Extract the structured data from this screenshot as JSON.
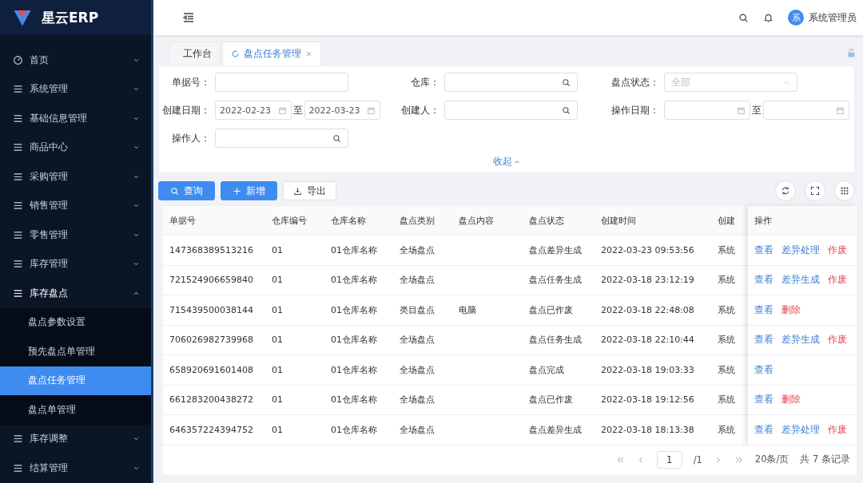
{
  "logo": {
    "text": "星云ERP"
  },
  "sidebar": {
    "items": [
      {
        "label": "首页",
        "kind": "dashboard",
        "expanded": false
      },
      {
        "label": "系统管理",
        "kind": "menu",
        "expanded": false
      },
      {
        "label": "基础信息管理",
        "kind": "menu",
        "expanded": false
      },
      {
        "label": "商品中心",
        "kind": "menu",
        "expanded": false
      },
      {
        "label": "采购管理",
        "kind": "menu",
        "expanded": false
      },
      {
        "label": "销售管理",
        "kind": "menu",
        "expanded": false
      },
      {
        "label": "零售管理",
        "kind": "menu",
        "expanded": false
      },
      {
        "label": "库存管理",
        "kind": "menu",
        "expanded": false
      },
      {
        "label": "库存盘点",
        "kind": "menu",
        "expanded": true,
        "children": [
          {
            "label": "盘点参数设置",
            "selected": false
          },
          {
            "label": "预先盘点单管理",
            "selected": false
          },
          {
            "label": "盘点任务管理",
            "selected": true
          },
          {
            "label": "盘点单管理",
            "selected": false
          }
        ]
      },
      {
        "label": "库存调整",
        "kind": "menu",
        "expanded": false
      },
      {
        "label": "结算管理",
        "kind": "menu",
        "expanded": false
      }
    ]
  },
  "header": {
    "avatar": "系",
    "user_name": "系统管理员"
  },
  "tabs": [
    {
      "label": "工作台",
      "selected": false
    },
    {
      "label": "盘点任务管理",
      "selected": true
    }
  ],
  "filter": {
    "fields": [
      {
        "label": "单据号：",
        "kind": "text"
      },
      {
        "label": "仓库：",
        "kind": "search"
      },
      {
        "label": "盘点状态：",
        "kind": "select",
        "placeholder": "全部"
      },
      {
        "label": "创建日期：",
        "kind": "date_range",
        "separator": "至",
        "values": [
          "2022-02-23",
          "2022-03-23"
        ]
      },
      {
        "label": "创建人：",
        "kind": "search"
      },
      {
        "label": "操作日期：",
        "kind": "date_range",
        "separator": "至"
      },
      {
        "label": "操作人：",
        "kind": "search"
      }
    ],
    "collapse_link": "收起"
  },
  "toolbar": {
    "buttons": [
      {
        "label": "查询",
        "kind": "primary"
      },
      {
        "label": "新增",
        "kind": "primary"
      },
      {
        "label": "导出",
        "kind": "default"
      }
    ]
  },
  "table": {
    "columns": [
      "单据号",
      "仓库编号",
      "仓库名称",
      "盘点类别",
      "盘点内容",
      "盘点状态",
      "创建时间",
      "创建",
      "操作"
    ],
    "rows": [
      {
        "cells": [
          "147368389513216",
          "01",
          "01仓库名称",
          "全场盘点",
          "",
          "盘点差异生成",
          "2022-03-23 09:53:56",
          "系统"
        ],
        "actions": [
          {
            "label": "查看",
            "kind": "normal"
          },
          {
            "label": "差异处理",
            "kind": "normal"
          },
          {
            "label": "作废",
            "kind": "danger"
          }
        ]
      },
      {
        "cells": [
          "721524906659840",
          "01",
          "01仓库名称",
          "全场盘点",
          "",
          "盘点任务生成",
          "2022-03-18 23:12:19",
          "系统"
        ],
        "actions": [
          {
            "label": "查看",
            "kind": "normal"
          },
          {
            "label": "差异生成",
            "kind": "normal"
          },
          {
            "label": "作废",
            "kind": "danger"
          }
        ]
      },
      {
        "cells": [
          "715439500038144",
          "01",
          "01仓库名称",
          "类目盘点",
          "电脑",
          "盘点已作废",
          "2022-03-18 22:48:08",
          "系统"
        ],
        "actions": [
          {
            "label": "查看",
            "kind": "normal"
          },
          {
            "label": "删除",
            "kind": "danger"
          }
        ]
      },
      {
        "cells": [
          "706026982739968",
          "01",
          "01仓库名称",
          "全场盘点",
          "",
          "盘点任务生成",
          "2022-03-18 22:10:44",
          "系统"
        ],
        "actions": [
          {
            "label": "查看",
            "kind": "normal"
          },
          {
            "label": "差异生成",
            "kind": "normal"
          },
          {
            "label": "作废",
            "kind": "danger"
          }
        ]
      },
      {
        "cells": [
          "658920691601408",
          "01",
          "01仓库名称",
          "全场盘点",
          "",
          "盘点完成",
          "2022-03-18 19:03:33",
          "系统"
        ],
        "actions": [
          {
            "label": "查看",
            "kind": "normal"
          }
        ]
      },
      {
        "cells": [
          "661283200438272",
          "01",
          "01仓库名称",
          "全场盘点",
          "",
          "盘点已作废",
          "2022-03-18 19:12:56",
          "系统"
        ],
        "actions": [
          {
            "label": "查看",
            "kind": "normal"
          },
          {
            "label": "删除",
            "kind": "danger"
          }
        ]
      },
      {
        "cells": [
          "646357224394752",
          "01",
          "01仓库名称",
          "全场盘点",
          "",
          "盘点差异生成",
          "2022-03-18 18:13:38",
          "系统"
        ],
        "actions": [
          {
            "label": "查看",
            "kind": "normal"
          },
          {
            "label": "差异处理",
            "kind": "normal"
          },
          {
            "label": "作废",
            "kind": "danger"
          }
        ]
      }
    ]
  },
  "pagination": {
    "page": "1",
    "total_pages": "/1",
    "page_size": "20条/页",
    "total": "共 7 条记录"
  }
}
